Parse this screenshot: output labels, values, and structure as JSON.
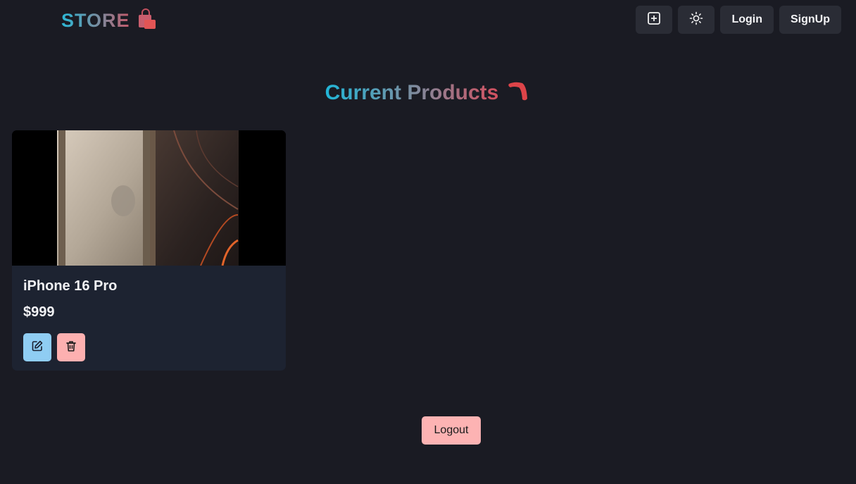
{
  "header": {
    "logo_text": "STORE",
    "buttons": {
      "login_label": "Login",
      "signup_label": "SignUp"
    }
  },
  "main": {
    "title_part1": "Current",
    "title_part2": "Products"
  },
  "products": [
    {
      "name": "iPhone 16 Pro",
      "price": "$999"
    }
  ],
  "footer": {
    "logout_label": "Logout"
  },
  "icons": {
    "logo": "shopping-bag-icon",
    "create": "plus-square-icon",
    "theme": "sun-icon",
    "title": "boomerang-icon",
    "edit": "edit-icon",
    "delete": "trash-icon"
  },
  "colors": {
    "background": "#1a1b23",
    "card": "#1d2331",
    "nav_button": "#2a2c35",
    "edit_button": "#8fcdf3",
    "delete_button": "#fdb0b0",
    "logout_button": "#fdb3b3"
  }
}
